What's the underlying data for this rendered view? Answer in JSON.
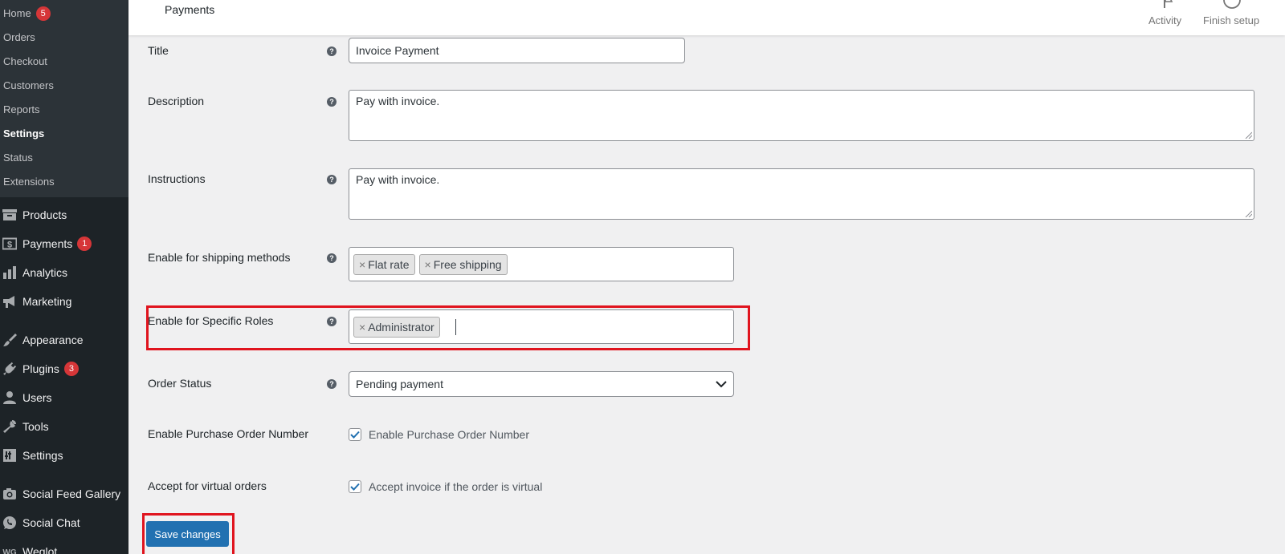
{
  "submenu": [
    {
      "label": "Home",
      "badge": "5"
    },
    {
      "label": "Orders"
    },
    {
      "label": "Checkout"
    },
    {
      "label": "Customers"
    },
    {
      "label": "Reports"
    },
    {
      "label": "Settings",
      "current": true
    },
    {
      "label": "Status"
    },
    {
      "label": "Extensions"
    }
  ],
  "menu": [
    {
      "label": "Products",
      "icon": "archive-icon"
    },
    {
      "label": "Payments",
      "icon": "money-icon",
      "badge": "1"
    },
    {
      "label": "Analytics",
      "icon": "bar-chart-icon"
    },
    {
      "label": "Marketing",
      "icon": "megaphone-icon"
    },
    {
      "label": "Appearance",
      "icon": "paintbrush-icon"
    },
    {
      "label": "Plugins",
      "icon": "plug-icon",
      "badge": "3"
    },
    {
      "label": "Users",
      "icon": "user-icon"
    },
    {
      "label": "Tools",
      "icon": "wrench-icon"
    },
    {
      "label": "Settings",
      "icon": "sliders-icon"
    },
    {
      "label": "Social Feed Gallery",
      "icon": "camera-icon"
    },
    {
      "label": "Social Chat",
      "icon": "chat-icon"
    },
    {
      "label": "Weglot",
      "icon": "wg-icon"
    }
  ],
  "topbar": {
    "title": "Payments",
    "activity": "Activity",
    "finish_setup": "Finish setup"
  },
  "form": {
    "title_label": "Title",
    "title_value": "Invoice Payment",
    "description_label": "Description",
    "description_value": "Pay with invoice.",
    "instructions_label": "Instructions",
    "instructions_value": "Pay with invoice.",
    "shipping_label": "Enable for shipping methods",
    "shipping_tags": [
      "Flat rate",
      "Free shipping"
    ],
    "roles_label": "Enable for Specific Roles",
    "roles_tags": [
      "Administrator"
    ],
    "order_status_label": "Order Status",
    "order_status_value": "Pending payment",
    "po_label": "Enable Purchase Order Number",
    "po_checkbox_label": "Enable Purchase Order Number",
    "po_checked": true,
    "virtual_label": "Accept for virtual orders",
    "virtual_checkbox_label": "Accept invoice if the order is virtual",
    "virtual_checked": true,
    "help_glyph": "?",
    "tag_remove_glyph": "×",
    "save_label": "Save changes"
  },
  "colors": {
    "accent": "#2271b1",
    "highlight": "#e0141e",
    "badge": "#d63638",
    "sidebar": "#1d2327"
  }
}
